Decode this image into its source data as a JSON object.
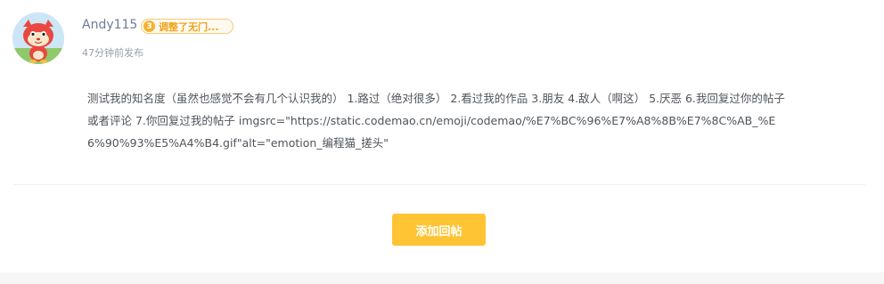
{
  "post": {
    "author": {
      "name": "Andy115",
      "level": "3",
      "badge_text": "调整了无门..."
    },
    "published_time": "47分钟前发布",
    "body": "测试我的知名度（虽然也感觉不会有几个认识我的） 1.路过（绝对很多） 2.看过我的作品 3.朋友 4.敌人（啊这） 5.厌恶 6.我回复过你的帖子或者评论 7.你回复过我的帖子 imgsrc=\"https://static.codemao.cn/emoji/codemao/%E7%BC%96%E7%A8%8B%E7%8C%AB_%E6%90%93%E5%A4%B4.gif\"alt=\"emotion_编程猫_搓头\""
  },
  "actions": {
    "reply_label": "添加回帖"
  },
  "colors": {
    "accent": "#fec433",
    "badge_border": "#f7c978",
    "badge_text": "#f0a21b",
    "username": "#6f7c95"
  },
  "icons": {
    "avatar": "red-cat-mascot-avatar",
    "level": "level-circle-icon"
  }
}
